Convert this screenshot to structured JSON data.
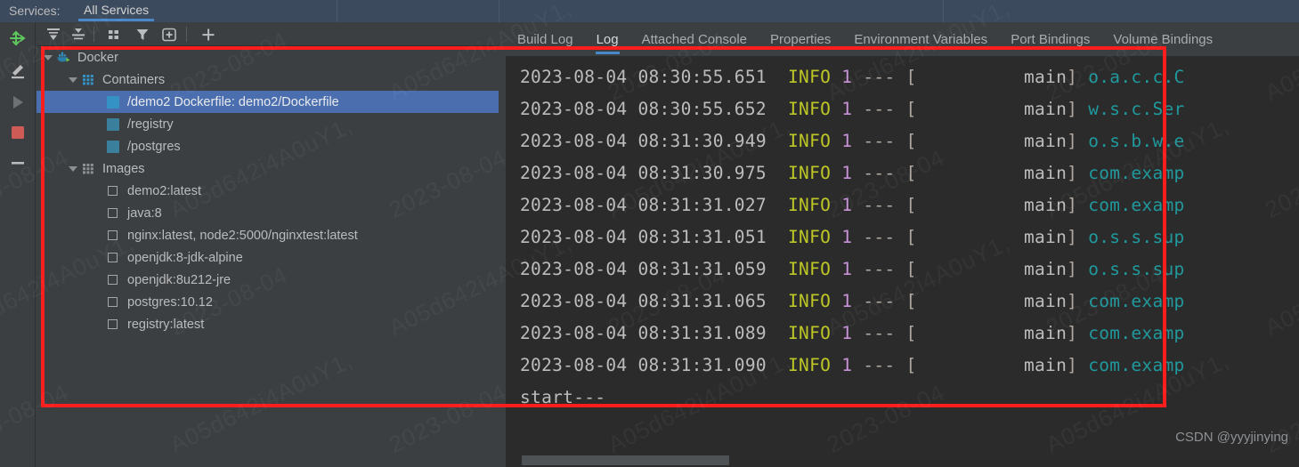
{
  "header": {
    "label": "Services:",
    "active_tab": "All Services",
    "bg_color": "#3c4a5e",
    "accent_color": "#4a88c7"
  },
  "rail": {
    "buttons": [
      {
        "name": "connect-icon",
        "title": "Connect"
      },
      {
        "name": "edit-pencil-icon",
        "title": "Edit Configuration"
      },
      {
        "name": "run-play-icon",
        "title": "Run"
      },
      {
        "name": "stop-square-icon",
        "title": "Stop"
      },
      {
        "name": "minus-icon",
        "title": "Remove"
      }
    ]
  },
  "tree_toolbar": {
    "buttons": [
      {
        "name": "expand-all-button",
        "title": "Expand All"
      },
      {
        "name": "collapse-all-button",
        "title": "Collapse All"
      },
      {
        "name": "group-by-button",
        "title": "Group By"
      },
      {
        "name": "filter-button",
        "title": "Filter"
      },
      {
        "name": "add-filter-button",
        "title": "Add Filter"
      },
      {
        "name": "add-button",
        "title": "Add"
      }
    ]
  },
  "tree": {
    "rows": [
      {
        "label": "Docker",
        "indent": 0,
        "icon": "docker-whale-icon",
        "twisty": true,
        "selected": false
      },
      {
        "label": "Containers",
        "indent": 1,
        "icon": "containers-grid-icon",
        "twisty": true,
        "selected": false
      },
      {
        "label": "/demo2 Dockerfile: demo2/Dockerfile",
        "indent": 2,
        "icon": "container-square-icon",
        "twisty": false,
        "selected": true
      },
      {
        "label": "/registry",
        "indent": 2,
        "icon": "container-square-icon",
        "twisty": false,
        "selected": false
      },
      {
        "label": "/postgres",
        "indent": 2,
        "icon": "container-square-icon",
        "twisty": false,
        "selected": false
      },
      {
        "label": "Images",
        "indent": 1,
        "icon": "images-grid-icon",
        "twisty": true,
        "selected": false
      },
      {
        "label": "demo2:latest",
        "indent": 2,
        "icon": "image-square-icon",
        "twisty": false,
        "selected": false
      },
      {
        "label": "java:8",
        "indent": 2,
        "icon": "image-square-icon",
        "twisty": false,
        "selected": false
      },
      {
        "label": "nginx:latest, node2:5000/nginxtest:latest",
        "indent": 2,
        "icon": "image-square-icon",
        "twisty": false,
        "selected": false
      },
      {
        "label": "openjdk:8-jdk-alpine",
        "indent": 2,
        "icon": "image-square-icon",
        "twisty": false,
        "selected": false
      },
      {
        "label": "openjdk:8u212-jre",
        "indent": 2,
        "icon": "image-square-icon",
        "twisty": false,
        "selected": false
      },
      {
        "label": "postgres:10.12",
        "indent": 2,
        "icon": "image-square-icon",
        "twisty": false,
        "selected": false
      },
      {
        "label": "registry:latest",
        "indent": 2,
        "icon": "image-square-icon",
        "twisty": false,
        "selected": false
      }
    ]
  },
  "tabs": [
    {
      "label": "Build Log",
      "active": false
    },
    {
      "label": "Log",
      "active": true
    },
    {
      "label": "Attached Console",
      "active": false
    },
    {
      "label": "Properties",
      "active": false
    },
    {
      "label": "Environment Variables",
      "active": false
    },
    {
      "label": "Port Bindings",
      "active": false
    },
    {
      "label": "Volume Bindings",
      "active": false
    }
  ],
  "log": {
    "lines": [
      {
        "ts": "2023-08-04 08:30:55.651",
        "level": "INFO",
        "pid": "1",
        "dash": "---",
        "thread": "main",
        "logger": "o.a.c.c.C"
      },
      {
        "ts": "2023-08-04 08:30:55.652",
        "level": "INFO",
        "pid": "1",
        "dash": "---",
        "thread": "main",
        "logger": "w.s.c.Ser"
      },
      {
        "ts": "2023-08-04 08:31:30.949",
        "level": "INFO",
        "pid": "1",
        "dash": "---",
        "thread": "main",
        "logger": "o.s.b.w.e"
      },
      {
        "ts": "2023-08-04 08:31:30.975",
        "level": "INFO",
        "pid": "1",
        "dash": "---",
        "thread": "main",
        "logger": "com.examp"
      },
      {
        "ts": "2023-08-04 08:31:31.027",
        "level": "INFO",
        "pid": "1",
        "dash": "---",
        "thread": "main",
        "logger": "com.examp"
      },
      {
        "ts": "2023-08-04 08:31:31.051",
        "level": "INFO",
        "pid": "1",
        "dash": "---",
        "thread": "main",
        "logger": "o.s.s.sup"
      },
      {
        "ts": "2023-08-04 08:31:31.059",
        "level": "INFO",
        "pid": "1",
        "dash": "---",
        "thread": "main",
        "logger": "o.s.s.sup"
      },
      {
        "ts": "2023-08-04 08:31:31.065",
        "level": "INFO",
        "pid": "1",
        "dash": "---",
        "thread": "main",
        "logger": "com.examp"
      },
      {
        "ts": "2023-08-04 08:31:31.089",
        "level": "INFO",
        "pid": "1",
        "dash": "---",
        "thread": "main",
        "logger": "com.examp"
      },
      {
        "ts": "2023-08-04 08:31:31.090",
        "level": "INFO",
        "pid": "1",
        "dash": "---",
        "thread": "main",
        "logger": "com.examp"
      }
    ],
    "trailing_text": "start---",
    "colors": {
      "timestamp": "#bcbcbc",
      "level": "#bdc726",
      "pid": "#c792d8",
      "logger": "#20999d",
      "background": "#2b2b2b"
    }
  },
  "watermark": {
    "csdn": "CSDN @yyyjinying",
    "tiles": [
      "2023-08-04",
      "A05d642i4A0uY1,",
      "2023-08-04",
      "A05d642i4A0uY1,"
    ]
  },
  "annotation": {
    "color": "#fc1d1d"
  }
}
